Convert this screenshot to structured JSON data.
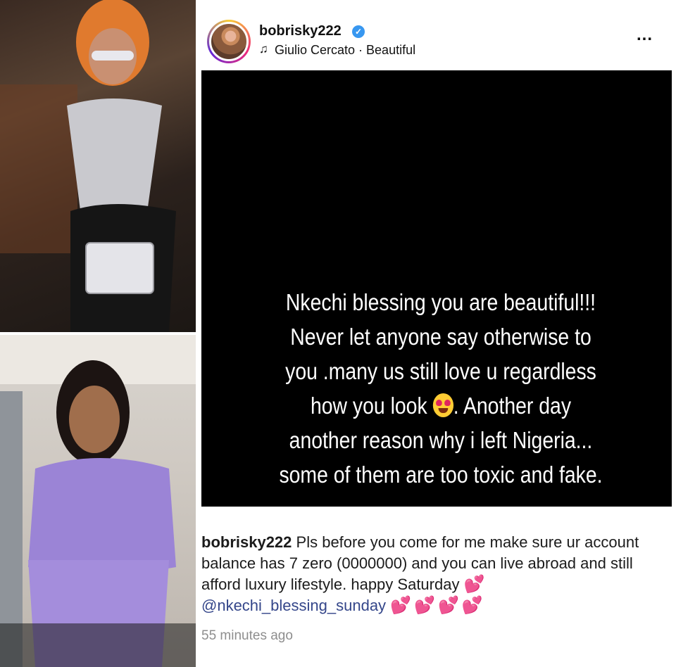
{
  "post": {
    "username": "bobrisky222",
    "verified": true,
    "music": "Giulio Cercato · Beautiful",
    "more": "...",
    "story_lines": [
      "Nkechi blessing you are beautiful!!!",
      "Never let anyone say otherwise to",
      "you .many us still love u regardless",
      "how you look",
      ". Another day",
      "another reason why i left Nigeria...",
      "some of them are too toxic and fake."
    ],
    "caption": {
      "username": "bobrisky222",
      "text": "Pls before you come for me make sure ur account balance has 7 zero (0000000) and you can live abroad and still afford luxury lifestyle. happy Saturday",
      "mention": "@nkechi_blessing_sunday",
      "hearts_inline": "💕",
      "hearts_end": "💕💕💕💕"
    },
    "timestamp": "55 minutes ago"
  },
  "icons": {
    "verified": "✓",
    "music": "♫"
  },
  "colors": {
    "verified_blue": "#3897f0",
    "mention": "#34468a",
    "hearts": "#e8459a"
  }
}
